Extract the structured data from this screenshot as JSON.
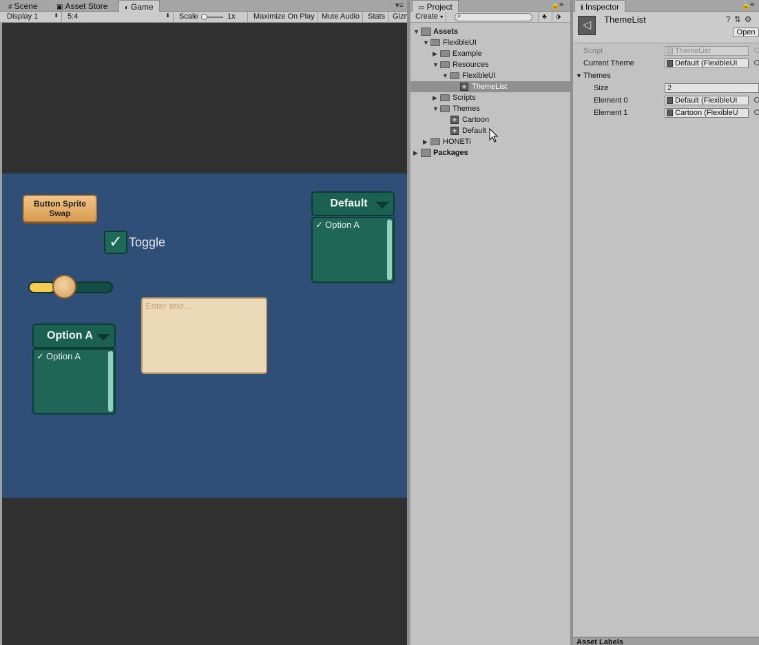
{
  "game_tabs": [
    {
      "label": "Scene",
      "icon": "grid-icon"
    },
    {
      "label": "Asset Store",
      "icon": "bag-icon"
    },
    {
      "label": "Game",
      "icon": "pacman-icon",
      "active": true
    }
  ],
  "game_toolbar": {
    "display": "Display 1",
    "aspect": "5:4",
    "scale_label": "Scale",
    "scale_value": "1x",
    "maximize": "Maximize On Play",
    "mute": "Mute Audio",
    "stats": "Stats",
    "gizmos": "Gizn"
  },
  "game_ui": {
    "button_sprite": "Button Sprite Swap",
    "toggle_label": "Toggle",
    "toggle_checked": true,
    "slider_value": 0.3,
    "input_placeholder": "Enter text...",
    "dropdown_default": {
      "label": "Default",
      "option": "Option A"
    },
    "dropdown_option": {
      "label": "Option A",
      "option": "Option A"
    },
    "check_glyph": "✓",
    "colors": {
      "canvas": "#2f4f79",
      "teal": "#1b6152",
      "gold": "#f3cc50",
      "button": "#e0aa63"
    }
  },
  "project": {
    "tab": "Project",
    "create": "Create",
    "search_placeholder": "",
    "tree": [
      {
        "label": "Assets",
        "bold": true,
        "expanded": true
      },
      {
        "label": "FlexibleUI",
        "expanded": true
      },
      {
        "label": "Example",
        "expanded": false
      },
      {
        "label": "Resources",
        "expanded": true
      },
      {
        "label": "FlexibleUI",
        "expanded": true
      },
      {
        "label": "ThemeList",
        "selected": true,
        "type": "asset"
      },
      {
        "label": "Scripts",
        "expanded": false
      },
      {
        "label": "Themes",
        "expanded": true
      },
      {
        "label": "Cartoon",
        "type": "asset"
      },
      {
        "label": "Default",
        "type": "asset"
      },
      {
        "label": "HONETi",
        "expanded": false
      },
      {
        "label": "Packages",
        "bold": true,
        "expanded": false
      }
    ]
  },
  "inspector": {
    "tab": "Inspector",
    "title": "ThemeList",
    "open_button": "Open",
    "script_label": "Script",
    "script_value": "ThemeList",
    "current_theme_label": "Current Theme",
    "current_theme_value": "Default (FlexibleUI",
    "themes_label": "Themes",
    "size_label": "Size",
    "size_value": "2",
    "element0_label": "Element 0",
    "element0_value": "Default (FlexibleUI",
    "element1_label": "Element 1",
    "element1_value": "Cartoon (FlexibleU",
    "asset_labels": "Asset Labels"
  }
}
